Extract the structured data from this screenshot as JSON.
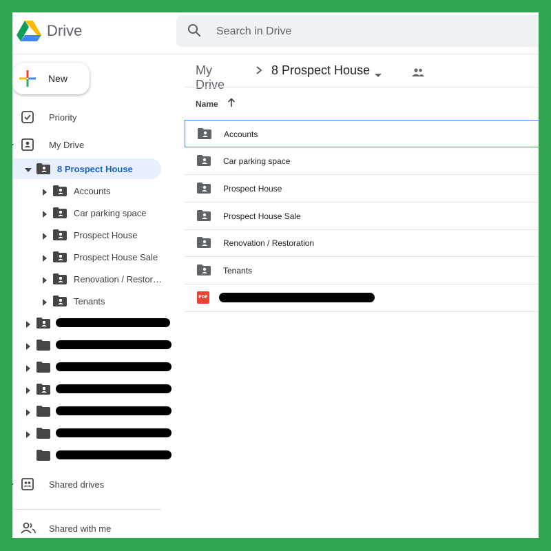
{
  "app": {
    "title": "Drive"
  },
  "search": {
    "placeholder": "Search in Drive"
  },
  "sidebar": {
    "new_label": "New",
    "priority_label": "Priority",
    "my_drive_label": "My Drive",
    "tree_root": "8 Prospect House",
    "tree_children": [
      "Accounts",
      "Car parking space",
      "Prospect House",
      "Prospect House Sale",
      "Renovation / Restor…",
      "Tenants"
    ],
    "shared_drives_label": "Shared drives",
    "shared_with_me_label": "Shared with me"
  },
  "breadcrumb": {
    "parent": "My Drive",
    "current": "8 Prospect House"
  },
  "list": {
    "name_header": "Name",
    "items": [
      "Accounts",
      "Car parking space",
      "Prospect House",
      "Prospect House Sale",
      "Renovation / Restoration",
      "Tenants"
    ],
    "pdf_badge": "PDF"
  },
  "colors": {
    "accent": "#1a73e8",
    "selected_bg": "#e8f0fe",
    "frame": "#2ea44f"
  }
}
